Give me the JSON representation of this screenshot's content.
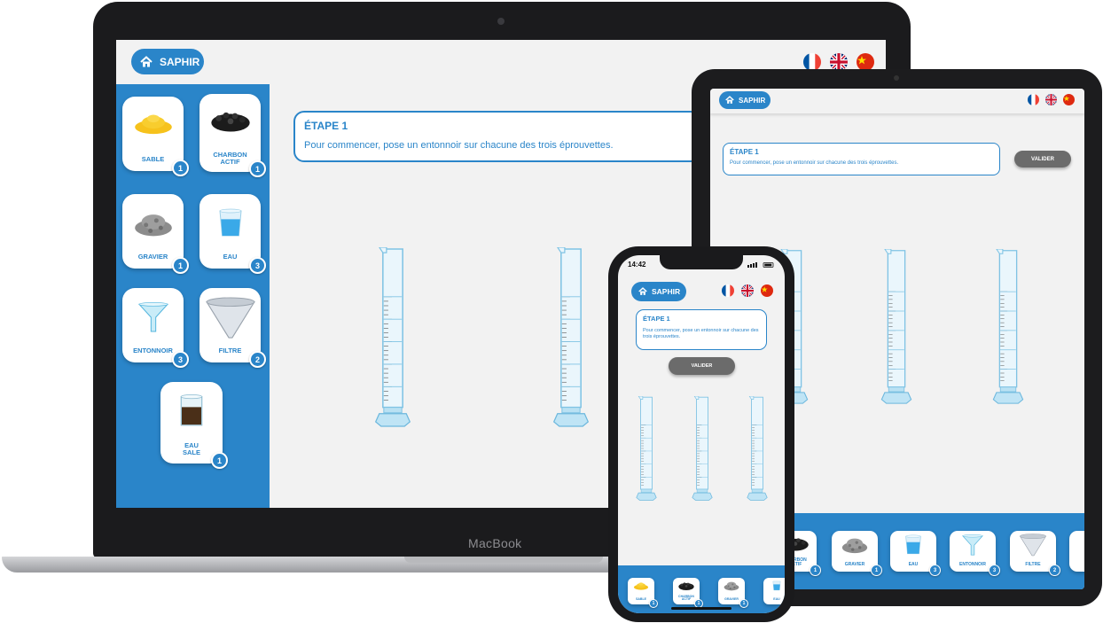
{
  "app": {
    "brand_label": "SAPHIR",
    "languages": [
      "french-flag",
      "uk-flag",
      "china-flag"
    ]
  },
  "step": {
    "title": "ÉTAPE 1",
    "instruction": "Pour commencer, pose un entonnoir sur chacune des trois éprouvettes.",
    "validate_label": "VALIDER"
  },
  "materials": [
    {
      "label": "SABLE",
      "count": "1",
      "icon": "sand-pile-icon"
    },
    {
      "label": "CHARBON ACTIF",
      "count": "1",
      "icon": "activated-charcoal-icon"
    },
    {
      "label": "GRAVIER",
      "count": "1",
      "icon": "gravel-pile-icon"
    },
    {
      "label": "EAU",
      "count": "3",
      "icon": "water-glass-icon"
    },
    {
      "label": "ENTONNOIR",
      "count": "3",
      "icon": "funnel-icon"
    },
    {
      "label": "FILTRE",
      "count": "2",
      "icon": "filter-cone-icon"
    },
    {
      "label": "EAU SALE",
      "count": "1",
      "icon": "dirty-water-beaker-icon"
    }
  ],
  "device_brand": "MacBook",
  "phone_status": {
    "time": "14:42"
  },
  "colors": {
    "primary": "#2a85c9",
    "background": "#f2f2f2",
    "button_grey": "#6b6b6b",
    "glass": "#a9d7ee"
  }
}
